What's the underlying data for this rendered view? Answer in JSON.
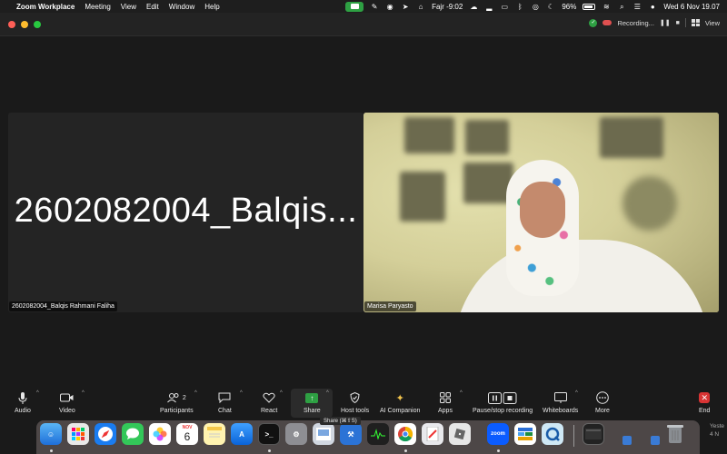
{
  "menubar": {
    "app_name": "Zoom Workplace",
    "items": [
      "Meeting",
      "View",
      "Edit",
      "Window",
      "Help"
    ],
    "prayer": "Fajr -9:02",
    "battery": "96%",
    "datetime": "Wed 6 Nov  19.07"
  },
  "titlebar": {
    "recording_label": "Recording...",
    "pause_glyph": "❚❚",
    "stop_glyph": "■",
    "view_label": "View"
  },
  "tiles": {
    "left_big_name": "2602082004_Balqis...",
    "left_name_tag": "2602082004_Balqis Rahmani Faliha",
    "right_name_tag": "Marisa Paryasto"
  },
  "toolbar": {
    "audio": "Audio",
    "video": "Video",
    "participants": "Participants",
    "participants_count": "2",
    "chat": "Chat",
    "react": "React",
    "share": "Share",
    "host_tools": "Host tools",
    "ai_companion": "AI Companion",
    "apps": "Apps",
    "pause_stop_recording": "Pause/stop recording",
    "whiteboards": "Whiteboards",
    "more": "More",
    "end": "End",
    "share_tooltip": "Share (⌘⇧S)"
  },
  "dock": {
    "calendar_month": "NOV",
    "calendar_day": "6",
    "zoom_label": "zoom",
    "peek_text_1": "Yeste",
    "peek_text_2": "4 N"
  },
  "colors": {
    "accent_green": "#2ea043",
    "end_red": "#d93434"
  }
}
